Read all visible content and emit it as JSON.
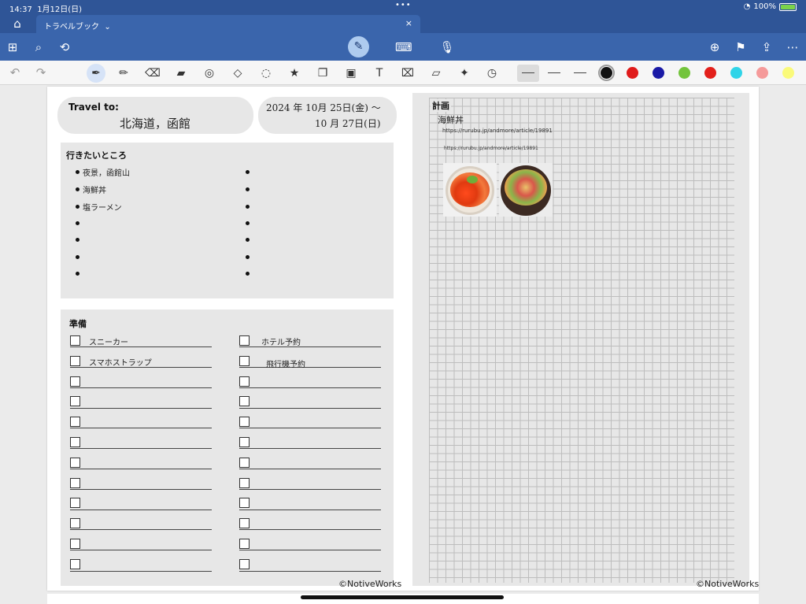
{
  "status_bar": {
    "time": "14:37",
    "date": "1月12日(日)",
    "battery": "100%"
  },
  "tab": {
    "title": "トラベルブック",
    "chevron": "⌄",
    "close": "×"
  },
  "toolbar": {
    "left_icons": [
      "grid-icon",
      "search-icon",
      "lasso-select-icon"
    ],
    "center_icons": [
      "pen-icon",
      "keyboard-icon",
      "microphone-icon"
    ],
    "right_icons": [
      "add-page-icon",
      "bookmark-icon",
      "share-icon",
      "more-icon"
    ]
  },
  "tools": {
    "items": [
      "pen-tool-icon",
      "pencil-icon",
      "eraser-icon",
      "highlighter-icon",
      "tape-icon",
      "shapes-icon",
      "lasso-icon",
      "stickers-icon",
      "elements-icon",
      "image-icon",
      "textbox-icon",
      "scan-icon",
      "ruler-icon",
      "laser-pointer-icon",
      "timer-icon"
    ],
    "colors": [
      "#111111",
      "#e01b1b",
      "#1a1aa6",
      "#73c43c",
      "#e3201b",
      "#2fd4e8",
      "#f59a9a",
      "#fafa7a"
    ]
  },
  "page": {
    "travel_to_label": "Travel to:",
    "destination": "北海道，函館",
    "dates_line1": "2024 年 10月 25日(金) 〜",
    "dates_line2": "10 月 27日(日)",
    "places_heading": "行きたいところ",
    "places": [
      "夜景，函館山",
      "海鮮丼",
      "塩ラーメン"
    ],
    "prep_heading": "準備",
    "prep_left": [
      "スニーカー",
      "スマホストラップ"
    ],
    "prep_right": [
      "ホテル予約",
      "飛行機予約"
    ],
    "plan_heading": "計画",
    "plan_item": "海鮮丼",
    "url1": "https://rurubu.jp/andmore/article/19891",
    "url2": "https://rurubu.jp/andmore/article/19891",
    "credit_left": "©NotiveWorks",
    "credit_right": "©NotiveWorks"
  }
}
